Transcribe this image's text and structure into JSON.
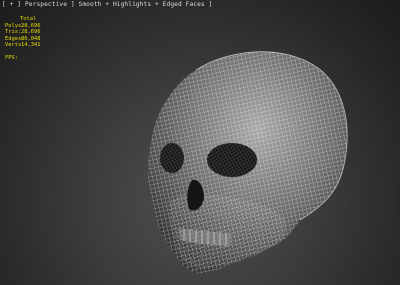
{
  "viewport": {
    "label_parts": [
      "[",
      "+",
      "]",
      "Perspective",
      "]",
      "Smooth + Highlights + Edged Faces",
      "]"
    ],
    "stats": {
      "total_label": "Total",
      "rows": [
        {
          "key": "Polys:",
          "value": "28,696"
        },
        {
          "key": "Tris:",
          "value": "28,696"
        },
        {
          "key": "Edges:",
          "value": "86,048"
        },
        {
          "key": "Verts:",
          "value": "14,341"
        }
      ],
      "fps_label": "FPS:"
    },
    "object": {
      "icon": "skull-wireframe-icon",
      "wire_color": "#ffffff"
    }
  }
}
